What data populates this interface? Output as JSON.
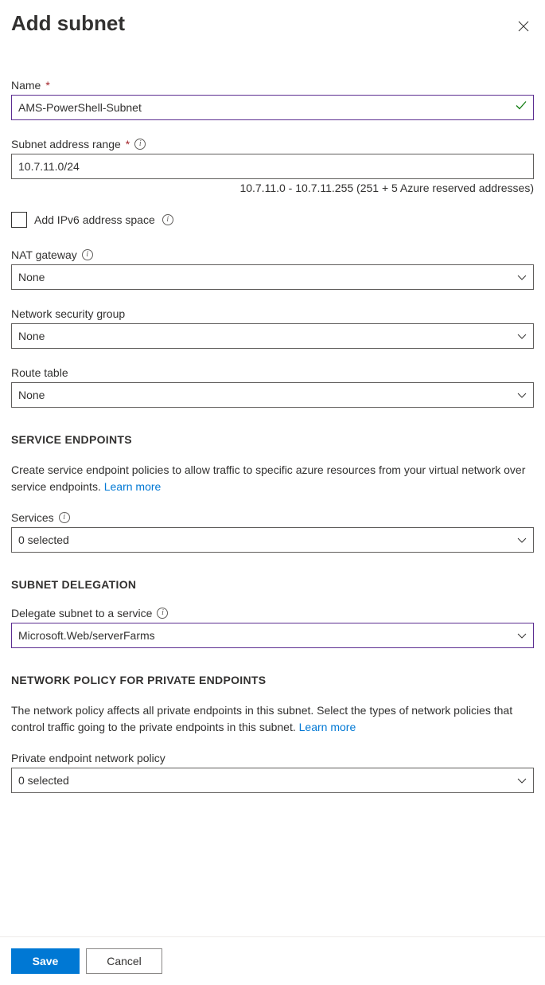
{
  "header": {
    "title": "Add subnet"
  },
  "fields": {
    "name": {
      "label": "Name",
      "value": "AMS-PowerShell-Subnet"
    },
    "addressRange": {
      "label": "Subnet address range",
      "value": "10.7.11.0/24",
      "helper": "10.7.11.0 - 10.7.11.255 (251 + 5 Azure reserved addresses)"
    },
    "ipv6": {
      "label": "Add IPv6 address space"
    },
    "natGateway": {
      "label": "NAT gateway",
      "value": "None"
    },
    "nsg": {
      "label": "Network security group",
      "value": "None"
    },
    "routeTable": {
      "label": "Route table",
      "value": "None"
    }
  },
  "serviceEndpoints": {
    "heading": "SERVICE ENDPOINTS",
    "desc": "Create service endpoint policies to allow traffic to specific azure resources from your virtual network over service endpoints. ",
    "learnMore": "Learn more",
    "servicesLabel": "Services",
    "servicesValue": "0 selected"
  },
  "delegation": {
    "heading": "SUBNET DELEGATION",
    "label": "Delegate subnet to a service",
    "value": "Microsoft.Web/serverFarms"
  },
  "networkPolicy": {
    "heading": "NETWORK POLICY FOR PRIVATE ENDPOINTS",
    "desc": "The network policy affects all private endpoints in this subnet. Select the types of network policies that control traffic going to the private endpoints in this subnet. ",
    "learnMore": "Learn more",
    "label": "Private endpoint network policy",
    "value": "0 selected"
  },
  "footer": {
    "save": "Save",
    "cancel": "Cancel"
  }
}
